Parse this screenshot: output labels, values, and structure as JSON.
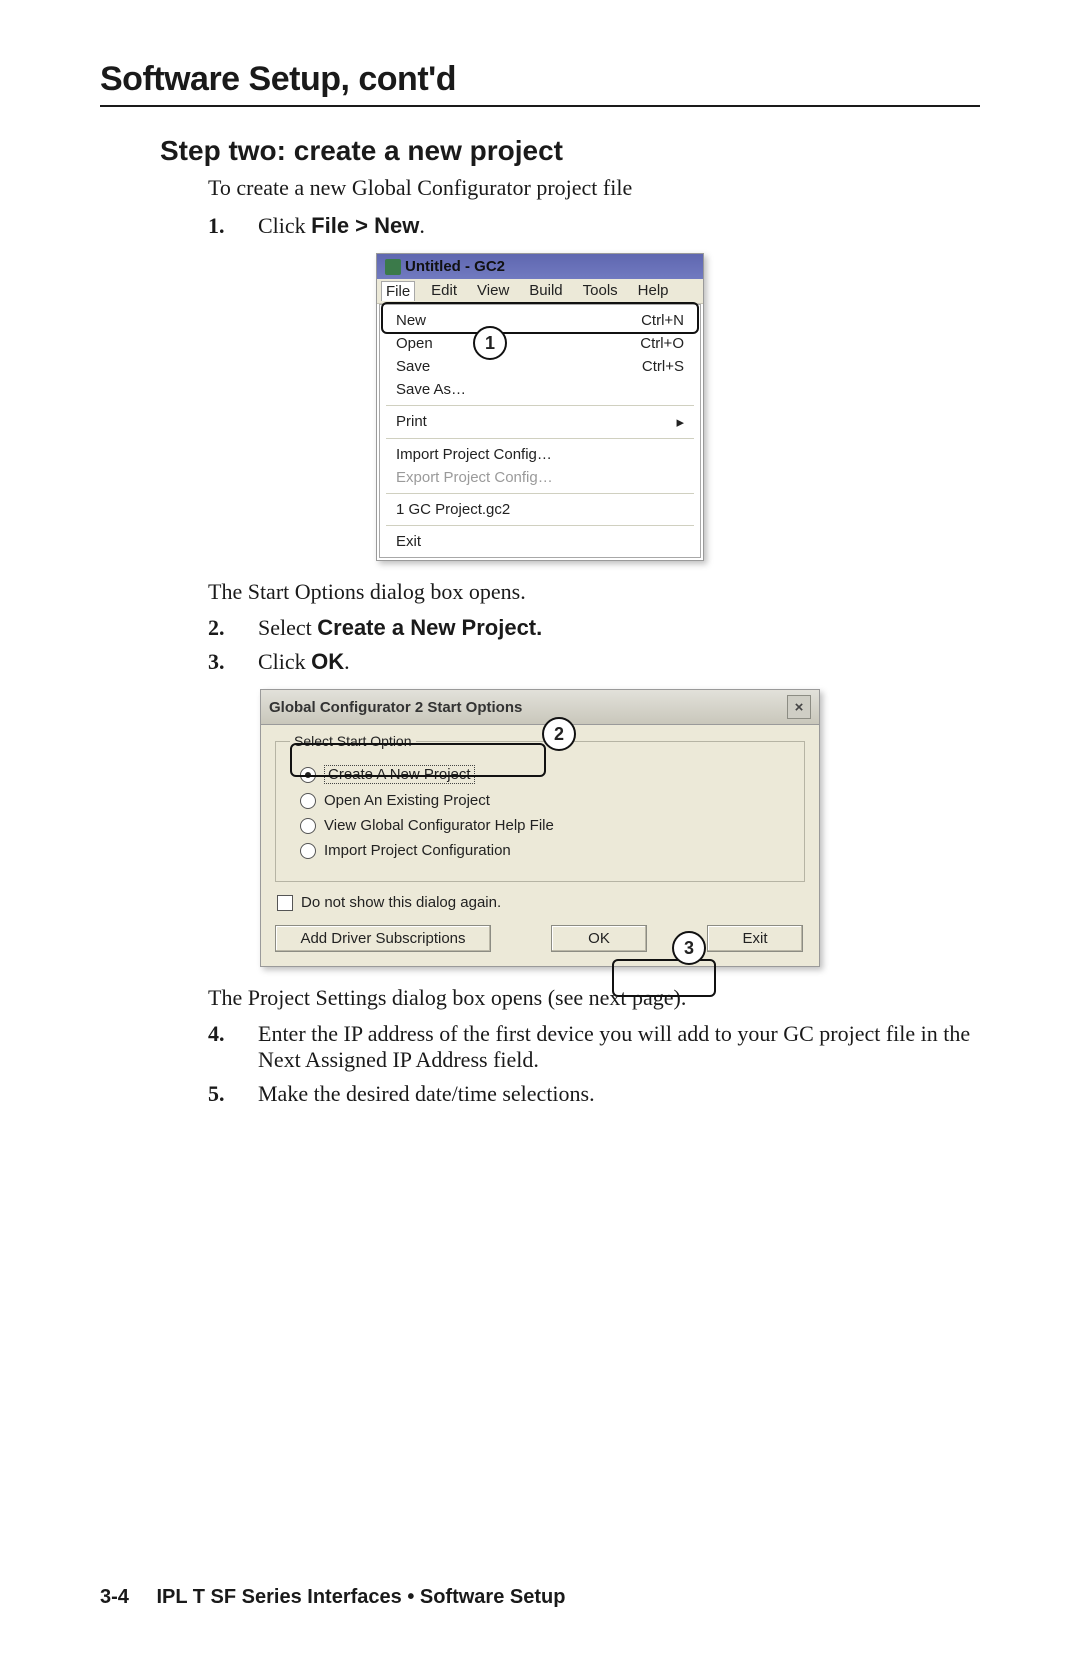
{
  "page": {
    "title": "Software Setup, cont'd",
    "step_heading": "Step two: create a new project",
    "lead": "To create a new Global Configurator project file",
    "footer_page": "3-4",
    "footer_text": "IPL T SF Series Interfaces • Software Setup"
  },
  "steps": {
    "s1": {
      "num": "1.",
      "pre": "Click ",
      "bold": "File > New",
      "post": "."
    },
    "after1": "The Start Options dialog box opens.",
    "s2": {
      "num": "2.",
      "pre": "Select ",
      "bold": "Create a New Project.",
      "post": ""
    },
    "s3": {
      "num": "3.",
      "pre": "Click ",
      "bold": "OK",
      "post": "."
    },
    "after3": "The Project Settings dialog box opens (see next page).",
    "s4": {
      "num": "4.",
      "text": "Enter the IP address of the first device you will add to your GC project file in the Next Assigned IP Address field."
    },
    "s5": {
      "num": "5.",
      "text": "Make the desired date/time selections."
    }
  },
  "fig1": {
    "title": "Untitled - GC2",
    "menus": {
      "file": "File",
      "edit": "Edit",
      "view": "View",
      "build": "Build",
      "tools": "Tools",
      "help": "Help"
    },
    "items": {
      "new": "New",
      "new_sc": "Ctrl+N",
      "open": "Open",
      "open_sc": "Ctrl+O",
      "save": "Save",
      "save_sc": "Ctrl+S",
      "saveas": "Save As…",
      "print": "Print",
      "import": "Import Project Config…",
      "export": "Export Project Config…",
      "recent": "1 GC Project.gc2",
      "exit": "Exit"
    },
    "callout": "1"
  },
  "fig2": {
    "title": "Global Configurator 2 Start Options",
    "close": "×",
    "legend": "Select Start Option",
    "opts": {
      "o1": "Create A New Project",
      "o2": "Open An Existing Project",
      "o3": "View Global Configurator Help File",
      "o4": "Import Project Configuration"
    },
    "dns": "Do not show this dialog again.",
    "btns": {
      "add": "Add Driver Subscriptions",
      "ok": "OK",
      "exit": "Exit"
    },
    "c2": "2",
    "c3": "3"
  }
}
